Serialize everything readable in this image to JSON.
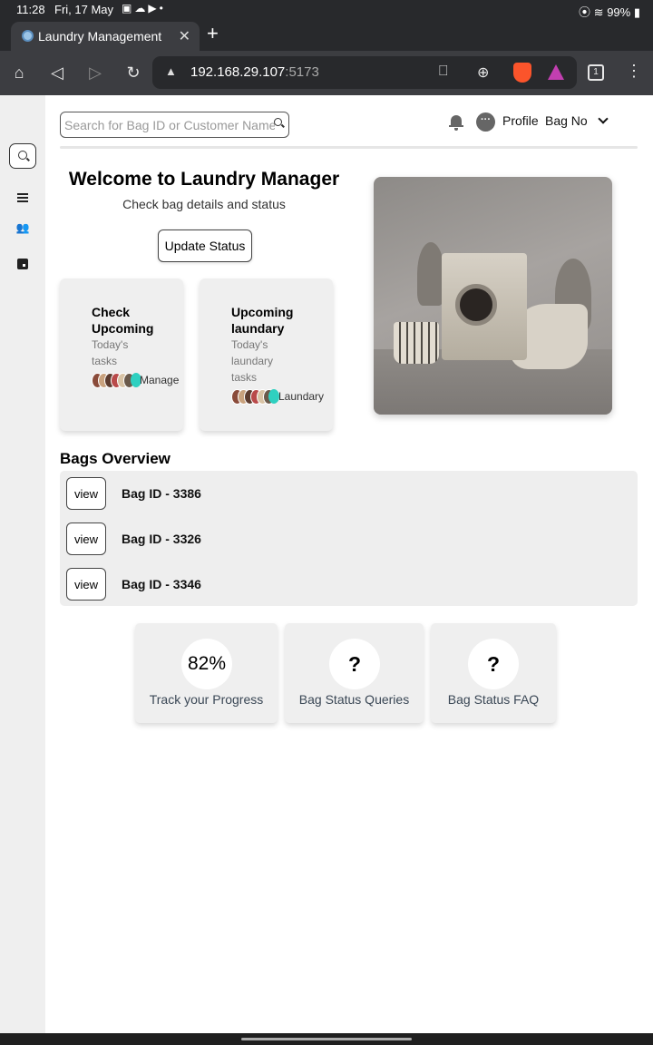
{
  "status_bar": {
    "time": "11:28",
    "date": "Fri, 17 May",
    "battery": "99%"
  },
  "browser": {
    "tab_title": "Laundry Management",
    "url_host": "192.168.29.107",
    "url_port": ":5173",
    "tab_count": "1"
  },
  "header": {
    "search_placeholder": "Search for Bag ID or Customer Name",
    "profile_label": "Profile",
    "bag_no_label": "Bag No"
  },
  "welcome": {
    "title": "Welcome to Laundry Manager",
    "subtitle": "Check bag details and status",
    "update_button": "Update Status"
  },
  "task_cards": [
    {
      "title": "Check Upcoming",
      "subtitle": "Today's tasks",
      "link": "Manage"
    },
    {
      "title": "Upcoming laundary",
      "subtitle": "Today's laundary tasks",
      "link": "Laundary"
    }
  ],
  "bags_overview": {
    "title": "Bags Overview",
    "view_label": "view",
    "bags": [
      {
        "label": "Bag ID - 3386"
      },
      {
        "label": "Bag ID - 3326"
      },
      {
        "label": "Bag ID - 3346"
      }
    ]
  },
  "stats": [
    {
      "value": "82%",
      "label": "Track your Progress",
      "progress": 0.82
    },
    {
      "value": "?",
      "label": "Bag Status Queries"
    },
    {
      "value": "?",
      "label": "Bag Status FAQ"
    }
  ],
  "colors": {
    "browser_chrome": "#28292c",
    "toolbar": "#3c3d41",
    "sidebar": "#efefef",
    "card": "#efefef",
    "accent_teal": "#2fd0c0",
    "brave_orange": "#fb542b"
  },
  "icons": {
    "sidebar": [
      "search-icon",
      "menu-icon",
      "users-icon",
      "calendar-icon"
    ],
    "header": [
      "bell-icon",
      "chat-icon",
      "chevron-down-icon"
    ]
  }
}
